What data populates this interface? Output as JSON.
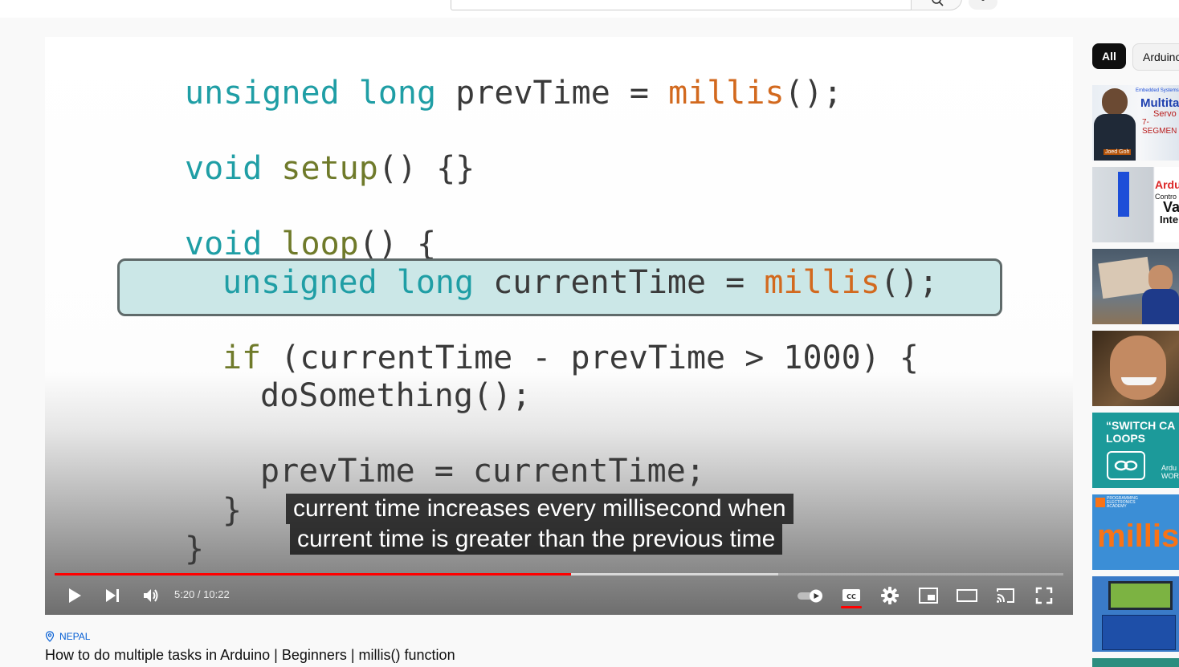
{
  "code_lines": [
    [
      "unsigned",
      " long",
      " prevTime = ",
      "millis",
      "();"
    ],
    [
      "void",
      " ",
      "setup",
      "() {}"
    ],
    [
      "void",
      " ",
      "loop",
      "() {"
    ],
    [
      "unsigned",
      " long",
      " currentTime = ",
      "millis",
      "();"
    ],
    [
      "if",
      " (currentTime - prevTime > 1000) {"
    ],
    [
      "doSomething();"
    ],
    [
      "prevTime = currentTime;"
    ],
    [
      "}"
    ],
    [
      "}"
    ]
  ],
  "player": {
    "captions": [
      "current time increases every millisecond when",
      "current time is greater than the previous time"
    ],
    "time": "5:20 / 10:22",
    "progress_fraction": 0.512,
    "buffered_fraction": 0.717,
    "controls": {
      "play": "play-icon",
      "next": "next-icon",
      "volume": "volume-icon",
      "autoplay": "autoplay-toggle-icon",
      "subtitles": "cc-icon",
      "settings": "gear-icon",
      "miniplayer": "miniplayer-icon",
      "theater": "theater-mode-icon",
      "cast": "cast-icon",
      "fullscreen": "fullscreen-icon"
    },
    "accent_color": "#ff0000"
  },
  "chips": [
    "All",
    "Arduino"
  ],
  "thumbnails": [
    {
      "texts": [
        "Embedded Systems",
        "Multita",
        "Servo",
        "7-SEGMEN",
        "Joed Goh"
      ]
    },
    {
      "texts": [
        "Ardu",
        "Contro",
        "Va",
        "Inte"
      ]
    },
    {
      "texts": []
    },
    {
      "texts": []
    },
    {
      "texts": [
        "“SWITCH CA",
        "LOOPS",
        "Ardu",
        "WOR"
      ]
    },
    {
      "texts": [
        "PROGRAMMING",
        "ELECTRONICS",
        "ACADEMY",
        "millis"
      ]
    },
    {
      "texts": []
    }
  ],
  "video": {
    "location": "NEPAL",
    "title": "How to do multiple tasks in Arduino | Beginners | millis() function"
  }
}
